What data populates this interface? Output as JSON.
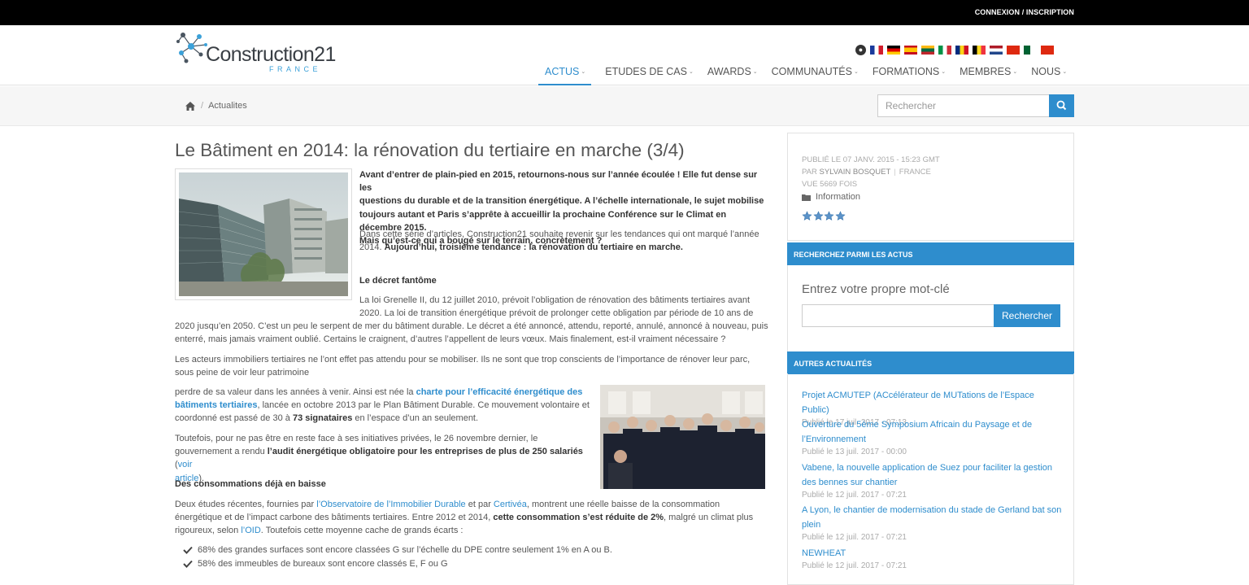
{
  "topbar": {
    "login": "CONNEXION / INSCRIPTION"
  },
  "logo": {
    "name": "Construction21",
    "sub": "FRANCE"
  },
  "flags": [
    "fr",
    "de",
    "es",
    "lt",
    "it",
    "ro",
    "be",
    "nl",
    "cn",
    "dz",
    "cn"
  ],
  "nav": [
    {
      "label": "ACTUS",
      "active": true
    },
    {
      "label": "ETUDES DE CAS"
    },
    {
      "label": "AWARDS"
    },
    {
      "label": "COMMUNAUTÉS"
    },
    {
      "label": "FORMATIONS"
    },
    {
      "label": "MEMBRES"
    },
    {
      "label": "NOUS"
    }
  ],
  "breadcrumb": {
    "current": "Actualites"
  },
  "search": {
    "placeholder": "Rechercher"
  },
  "article": {
    "title": "Le Bâtiment en 2014: la rénovation du tertiaire en marche (3/4)",
    "intro": [
      "Avant d’entrer de plain-pied en 2015, retournons-nous sur l’année écoulée ! Elle fut dense sur les",
      "questions du durable et de la transition énergétique. A l’échelle internationale, le sujet mobilise",
      "toujours autant et Paris s’apprête à accueillir la prochaine Conférence sur le Climat en décembre 2015.",
      "Mais qu’est-ce qui a bougé sur le terrain, concrètement ?"
    ],
    "p2_l1": "Dans cette série d’articles, Construction21 souhaite revenir sur les tendances qui ont marqué l’année",
    "p2_l2a": "2014. ",
    "p2_l2b": "Aujourd’hui, troisième tendance : la rénovation du tertiaire en marche.",
    "h_decret": "Le décret fantôme",
    "p3": [
      "La loi Grenelle II, du 12 juillet 2010, prévoit l’obligation de rénovation des bâtiments tertiaires avant",
      "2020. La loi de transition énergétique prévoit de prolonger cette obligation par période de 10 ans de",
      "2020 jusqu’en 2050. C’est un peu le serpent de mer du bâtiment durable. Le décret a été annoncé, attendu, reporté, annulé, annoncé à nouveau, puis",
      "enterré, mais jamais vraiment oublié. Certains le craignent, d’autres l’appellent de leurs vœux. Mais finalement, est-il vraiment nécessaire ?"
    ],
    "p4": [
      "Les acteurs immobiliers tertiaires ne l’ont effet pas attendu pour se mobiliser. Ils ne sont que trop conscients de l’importance de rénover leur parc,",
      "sous peine de voir leur patrimoine"
    ],
    "p5_l1a": "perdre de sa valeur dans les années à venir. Ainsi est née la ",
    "p5_link1": "charte pour l’efficacité énergétique des",
    "p5_link2": "bâtiments tertiaires",
    "p5_l2b": ", lancée en octobre 2013 par le Plan Bâtiment Durable. Ce mouvement volontaire et",
    "p5_l3a": "coordonné est passé de 30 à ",
    "p5_l3b": "73 signataires",
    "p5_l3c": " en l’espace d’un an seulement.",
    "p6_l1": "Toutefois, pour ne pas être en reste face à ses initiatives privées, le 26 novembre dernier, le",
    "p6_l2a": "gouvernement a rendu ",
    "p6_l2b": "l’audit énergétique obligatoire pour les entreprises de plus de 250 salariés",
    "p6_l2c": " (",
    "p6_l2d": "voir",
    "p6_l3a": "article",
    "p6_l3b": ").",
    "h_conso": "Des consommations déjà en baisse",
    "p7_l1a": "Deux études récentes, fournies par ",
    "p7_l1b": "l’Observatoire de l’Immobilier Durable",
    "p7_l1c": " et par ",
    "p7_l1d": "Certivéa",
    "p7_l1e": ", montrent une réelle baisse de la consommation",
    "p7_l2a": "énergétique et de l’impact carbone des bâtiments tertiaires. Entre 2012 et 2014, ",
    "p7_l2b": "cette consommation s’est réduite de 2%",
    "p7_l2c": ", malgré un climat plus",
    "p7_l3a": "rigoureux, selon ",
    "p7_l3b": "l’OID",
    "p7_l3c": ". Toutefois cette moyenne cache de grands écarts :",
    "checks": [
      "68% des grandes surfaces sont encore classées G sur l’échelle du DPE contre seulement 1% en A ou B.",
      "58% des immeubles de bureaux sont encore classés E, F ou G"
    ]
  },
  "meta": {
    "published": "PUBLIÉ LE 07 JANV. 2015 - 15:23 GMT",
    "by": "PAR",
    "author": "SYLVAIN BOSQUET",
    "country": "FRANCE",
    "views": "VUE 5669 FOIS",
    "category": "Information",
    "rating": 4
  },
  "search_panel": {
    "heading": "RECHERCHEZ PARMI LES ACTUS",
    "label": "Entrez votre propre mot-clé",
    "button": "Rechercher"
  },
  "news": {
    "heading": "AUTRES ACTUALITÉS",
    "items": [
      {
        "title": "Projet ACMUTEP (ACcélérateur de MUTations de l’Espace Public)",
        "date": "Publié le 17 juil. 2017 - 07:13"
      },
      {
        "title": "Ouverture du 5ème Symposium Africain du Paysage et de l’Environnement",
        "date": "Publié le 13 juil. 2017 - 00:00"
      },
      {
        "title": "Vabene, la nouvelle application de Suez pour faciliter la gestion des bennes sur chantier",
        "date": "Publié le 12 juil. 2017 - 07:21"
      },
      {
        "title": "A Lyon, le chantier de modernisation du stade de Gerland bat son plein",
        "date": "Publié le 12 juil. 2017 - 07:21"
      },
      {
        "title": "NEWHEAT",
        "date": "Publié le 12 juil. 2017 - 07:21"
      }
    ]
  },
  "colors": {
    "accent": "#2e8dcd",
    "topbar": "#000000",
    "text": "#555555"
  }
}
